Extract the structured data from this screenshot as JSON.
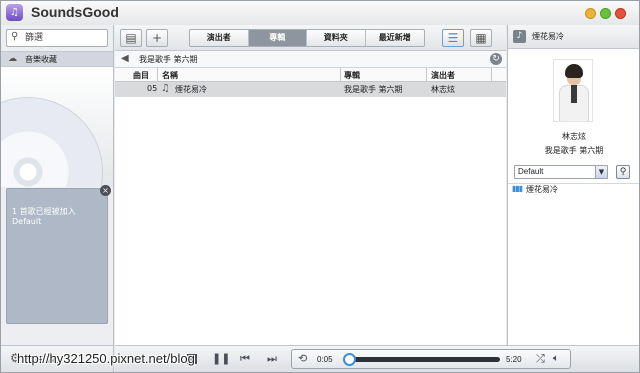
{
  "window": {
    "title": "SoundsGood",
    "logo_glyph": "♫"
  },
  "sidebar": {
    "search_placeholder": "篩選",
    "search_icon": "search-icon",
    "library_label": "音樂收藏",
    "notification_text": "1 首歌已經被加入 Default",
    "prefs_label": "偏好設定"
  },
  "toolbar": {
    "new_icon": "save-icon",
    "add_icon": "plus-icon",
    "tabs": [
      {
        "label": "演出者",
        "active": false
      },
      {
        "label": "專輯",
        "active": true
      },
      {
        "label": "資料夾",
        "active": false
      },
      {
        "label": "最近新增",
        "active": false
      }
    ]
  },
  "breadcrumb": {
    "text": "我是歌手 第六期"
  },
  "table": {
    "columns": [
      "曲目",
      "名稱",
      "專輯",
      "演出者"
    ],
    "rows": [
      {
        "track": "05",
        "name": "煙花易冷",
        "album": "我是歌手 第六期",
        "artist": "林志炫"
      }
    ]
  },
  "now_playing": {
    "title": "煙花易冷",
    "artist": "林志炫",
    "album": "我是歌手 第六期"
  },
  "playlist": {
    "selected": "Default",
    "items": [
      "煙花易冷"
    ]
  },
  "player": {
    "current_time": "0:05",
    "total_time": "5:20",
    "progress_fraction": 0.016
  },
  "watermark": "http://hy321250.pixnet.net/blog",
  "colors": {
    "accent": "#3b8fdd",
    "close": "#e5533f",
    "minimize": "#e8b53a",
    "maximize": "#6cc040"
  }
}
